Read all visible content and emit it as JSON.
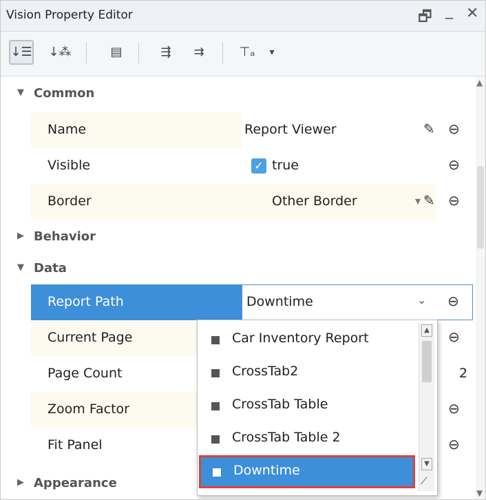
{
  "window": {
    "title": "Vision Property Editor",
    "restore_glyph": "🗗",
    "minimize_glyph": "_",
    "close_glyph": "✕"
  },
  "toolbar": {
    "buttons": [
      {
        "name": "sort-categorized-icon",
        "glyph": "↓☰"
      },
      {
        "name": "sort-alphabetical-icon",
        "glyph": "↓⁂"
      },
      {
        "name": "description-icon",
        "glyph": "▤"
      },
      {
        "name": "expand-all-icon",
        "glyph": "⇶"
      },
      {
        "name": "collapse-all-icon",
        "glyph": "⇉"
      },
      {
        "name": "filter-icon",
        "glyph": "⊤ₐ"
      },
      {
        "name": "dropdown-arrow-icon",
        "glyph": "▾"
      }
    ]
  },
  "sections": {
    "common": "Common",
    "behavior": "Behavior",
    "data": "Data",
    "appearance": "Appearance"
  },
  "properties": {
    "name": {
      "label": "Name",
      "value": "Report Viewer"
    },
    "visible": {
      "label": "Visible",
      "value": "true",
      "checked": true
    },
    "border": {
      "label": "Border",
      "value": "Other Border"
    },
    "report_path": {
      "label": "Report Path",
      "value": "Downtime"
    },
    "current_page": {
      "label": "Current Page"
    },
    "page_count": {
      "label": "Page Count",
      "value": "2"
    },
    "zoom_factor": {
      "label": "Zoom Factor"
    },
    "fit_panel": {
      "label": "Fit Panel"
    }
  },
  "dropdown": {
    "options": [
      "Car Inventory Report",
      "CrossTab2",
      "CrossTab Table",
      "CrossTab Table 2",
      "Downtime"
    ],
    "selected": "Downtime"
  },
  "icons": {
    "pencil": "✎",
    "link": "⊖",
    "chevron": "⌄",
    "dropdown_triangle": "▾",
    "expanded": "▼",
    "collapsed": "▶",
    "check": "✓"
  },
  "colors": {
    "selection": "#3d8fd9",
    "highlight_border": "#e1403b",
    "row_background": "#fdfbf0"
  }
}
